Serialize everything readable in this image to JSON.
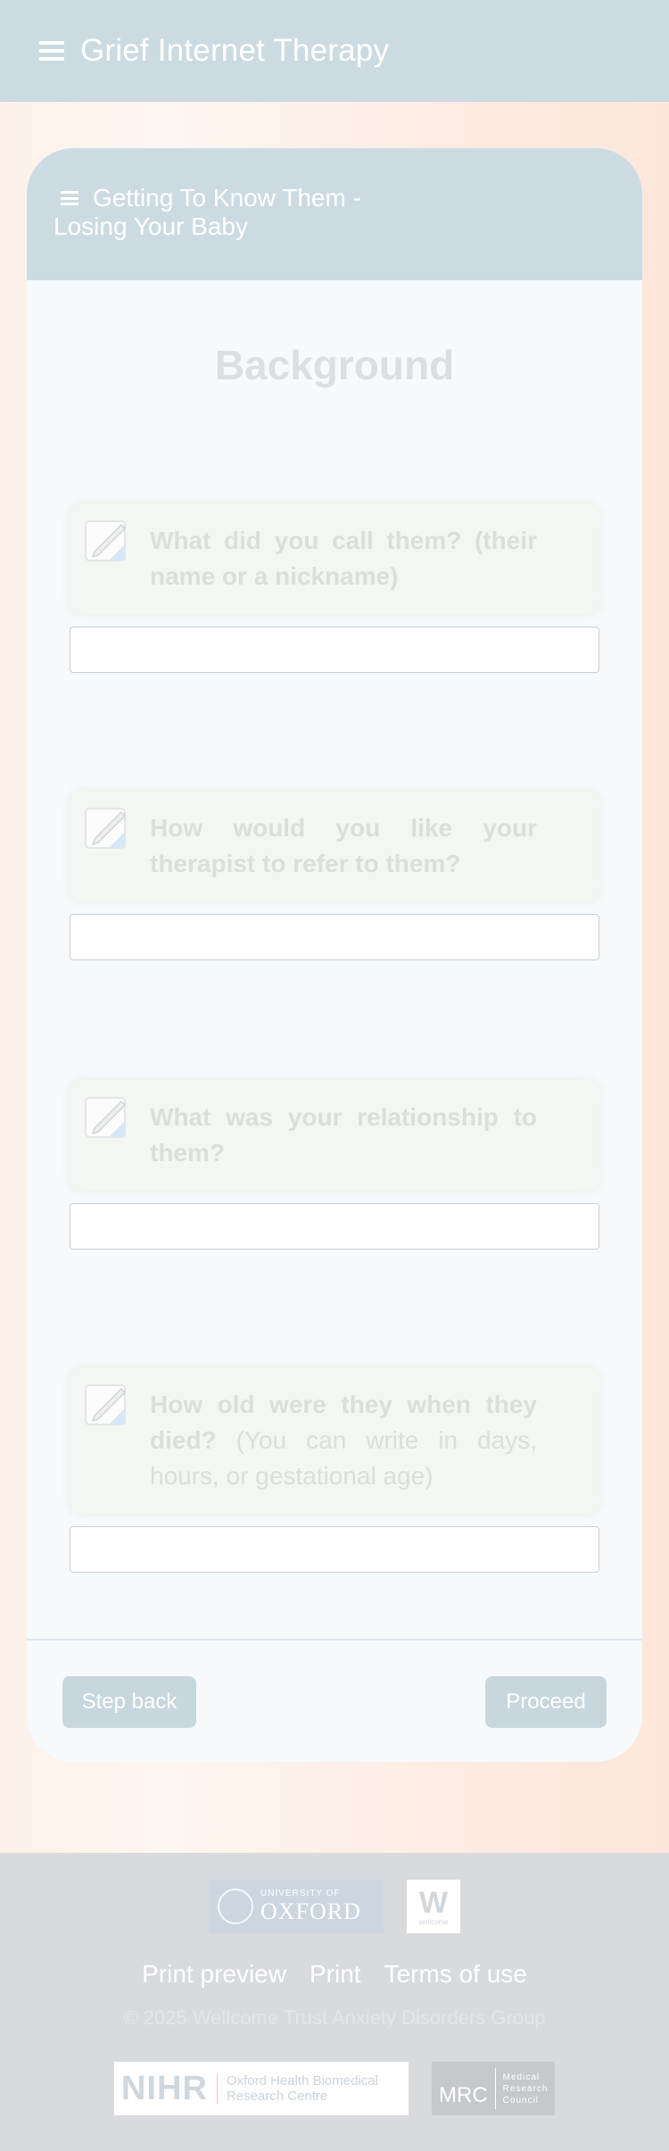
{
  "header": {
    "title": "Grief Internet Therapy"
  },
  "card": {
    "heading_line1": "Getting To Know Them -",
    "heading_line2": "Losing Your Baby",
    "section_title": "Background"
  },
  "questions": [
    {
      "bold": "What did you call them? (their name or a nickname)",
      "rest": "",
      "value": ""
    },
    {
      "bold": "How would you like your therapist to refer to them?",
      "rest": "",
      "value": ""
    },
    {
      "bold": "What was your relationship to them?",
      "rest": "",
      "value": ""
    },
    {
      "bold": "How old were they when they died?",
      "rest": " (You can write in days, hours, or gestational age)",
      "value": ""
    }
  ],
  "buttons": {
    "back": "Step back",
    "proceed": "Proceed"
  },
  "footer": {
    "oxford_small": "UNIVERSITY OF",
    "oxford_large": "OXFORD",
    "wellcome_letter": "W",
    "wellcome_text": "wellcome",
    "links": [
      "Print preview",
      "Print",
      "Terms of use"
    ],
    "copyright": "© 2025 Wellcome Trust Anxiety Disorders Group",
    "nihr": "NIHR",
    "nihr_sub_line1": "Oxford Health Biomedical",
    "nihr_sub_line2": "Research Centre",
    "mrc": "MRC",
    "mrc_sub": [
      "Medical",
      "Research",
      "Council"
    ]
  },
  "colors": {
    "header_bg": "#ccdbe1",
    "button_bg": "#c8d7de",
    "footer_bg": "#d8dadd"
  }
}
